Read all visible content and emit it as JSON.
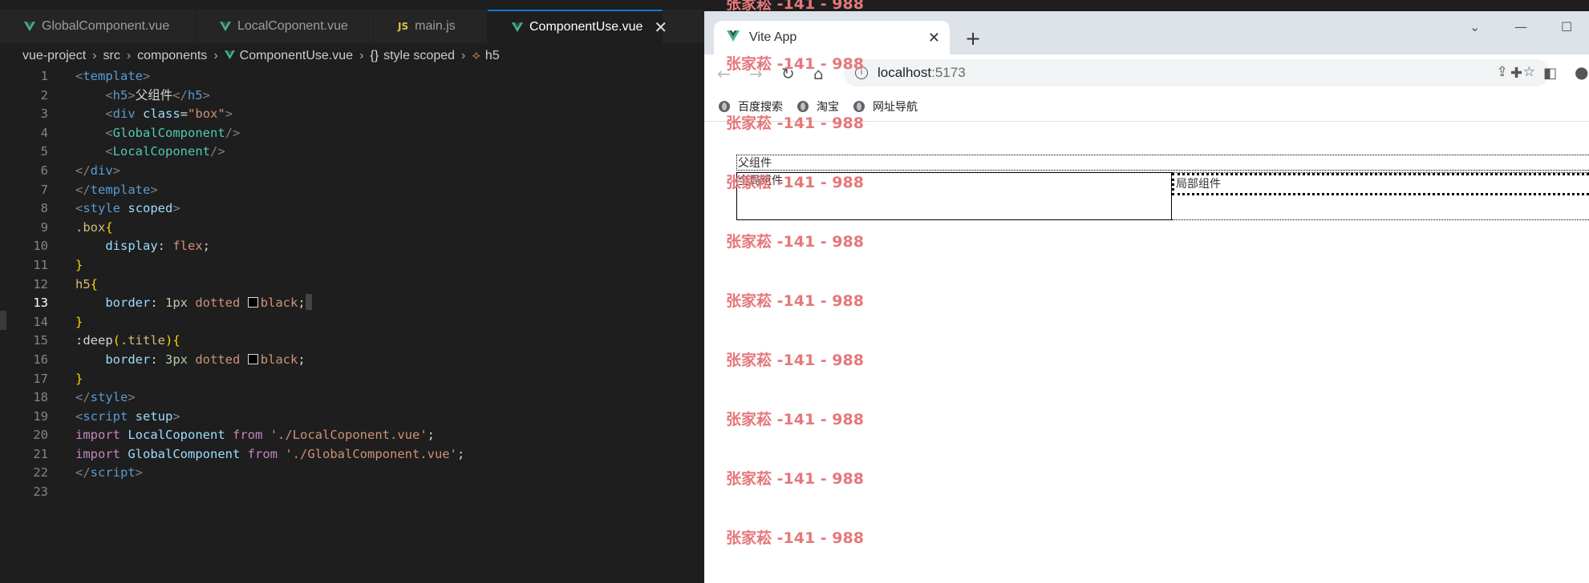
{
  "editor": {
    "tabs": [
      {
        "label": "GlobalComponent.vue",
        "icon": "vue-icon"
      },
      {
        "label": "LocalCoponent.vue",
        "icon": "vue-icon"
      },
      {
        "label": "main.js",
        "icon": "js-icon"
      },
      {
        "label": "ComponentUse.vue",
        "icon": "vue-icon",
        "active": true
      }
    ],
    "breadcrumb": [
      "vue-project",
      "src",
      "components",
      "ComponentUse.vue",
      "style scoped",
      "h5"
    ],
    "current_line": 13,
    "line_numbers": [
      "1",
      "2",
      "3",
      "4",
      "5",
      "6",
      "7",
      "8",
      "9",
      "10",
      "11",
      "12",
      "13",
      "14",
      "15",
      "16",
      "17",
      "18",
      "19",
      "20",
      "21",
      "22",
      "23"
    ],
    "code": {
      "l1": "template",
      "l2_tag": "h5",
      "l2_text": "父组件",
      "l3_tag": "div",
      "l3_attr": "class",
      "l3_val": "\"box\"",
      "l4": "GlobalComponent",
      "l5": "LocalCoponent",
      "l6": "div",
      "l7": "template",
      "l8_tag": "style",
      "l8_attr": "scoped",
      "l9": ".box",
      "l10_prop": "display",
      "l10_val": "flex",
      "l12": "h5",
      "l13_prop": "border",
      "l13_num": "1px",
      "l13_style": "dotted",
      "l13_color": "black",
      "l15_fn": ":deep",
      "l15_arg": ".title",
      "l16_prop": "border",
      "l16_num": "3px",
      "l16_style": "dotted",
      "l16_color": "black",
      "l18": "style",
      "l19_tag": "script",
      "l19_attr": "setup",
      "l20_kw1": "import",
      "l20_id": "LocalCoponent",
      "l20_kw2": "from",
      "l20_str": "'./LocalCoponent.vue'",
      "l21_kw1": "import",
      "l21_id": "GlobalComponent",
      "l21_kw2": "from",
      "l21_str": "'./GlobalComponent.vue'",
      "l22": "script"
    }
  },
  "browser": {
    "tab_title": "Vite App",
    "url_host": "localhost",
    "url_port": ":5173",
    "bookmarks": [
      "百度搜索",
      "淘宝",
      "网址导航"
    ],
    "page": {
      "parent_label": "父组件",
      "global_label": "全局组件",
      "local_label": "局部组件"
    }
  },
  "watermark": "张家菘 -141 - 988",
  "colors": {
    "accent": "#0e7ad3",
    "watermark": "#e6777a",
    "vue_green": "#41b883"
  }
}
